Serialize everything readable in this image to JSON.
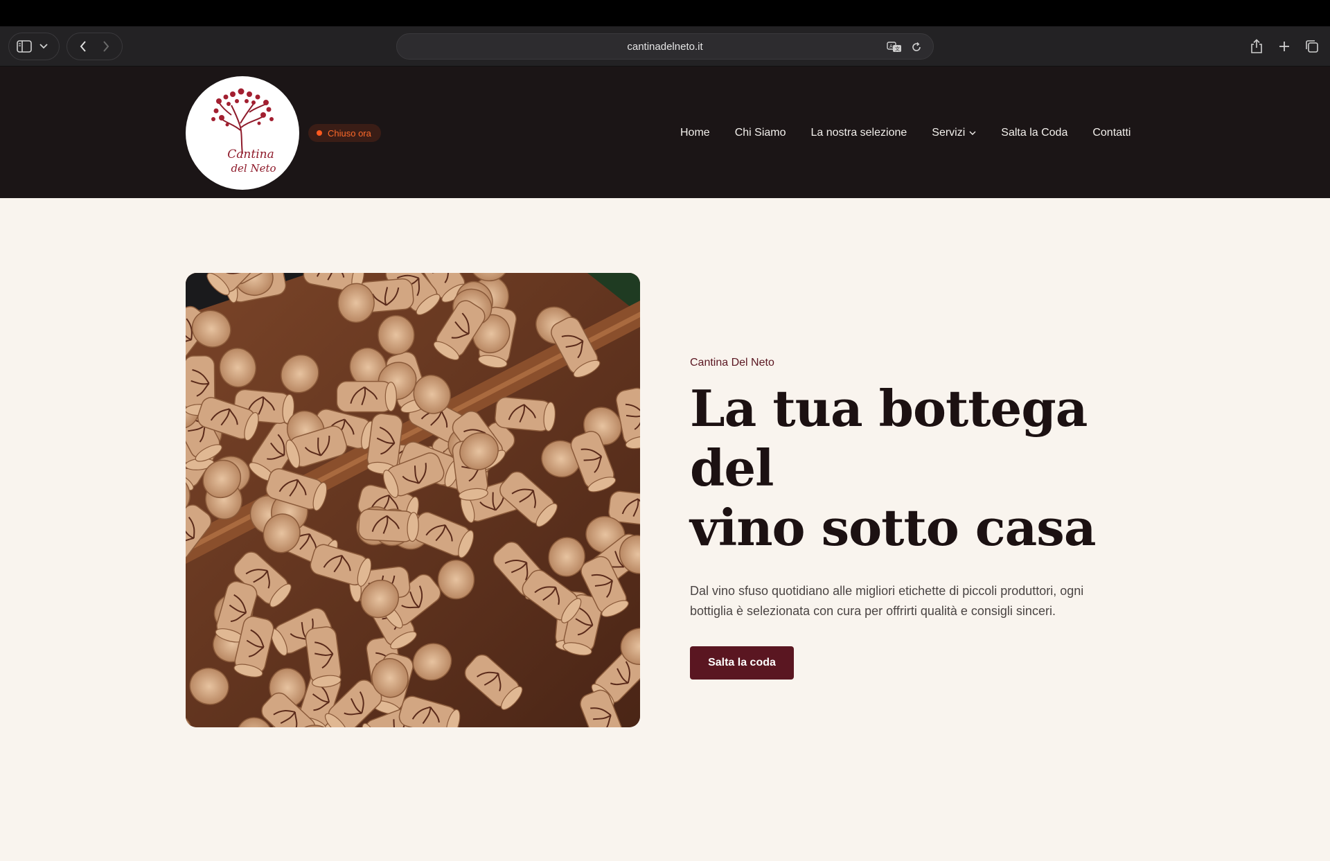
{
  "browser": {
    "url": "cantinadelneto.it",
    "icons": [
      "sidebar-icon",
      "chevron-down-icon",
      "back-icon",
      "forward-icon",
      "translate-icon",
      "reload-icon",
      "share-icon",
      "new-tab-icon",
      "tabs-overview-icon"
    ]
  },
  "header": {
    "logo": {
      "line1": "Cantina",
      "line2": "del Neto"
    },
    "status": {
      "text": "Chiuso ora",
      "color": "#ff5a1f"
    },
    "nav": [
      {
        "label": "Home"
      },
      {
        "label": "Chi Siamo"
      },
      {
        "label": "La nostra selezione"
      },
      {
        "label": "Servizi",
        "has_dropdown": true
      },
      {
        "label": "Salta la Coda"
      },
      {
        "label": "Contatti"
      }
    ]
  },
  "hero": {
    "eyebrow": "Cantina Del Neto",
    "title_line1": "La tua bottega del",
    "title_line2": "vino sotto casa",
    "description": "Dal vino sfuso quotidiano alle migliori etichette di piccoli produttori, ogni bottiglia è selezionata con cura per offrirti qualità e consigli sinceri.",
    "cta_label": "Salta la coda"
  },
  "colors": {
    "header_bg": "#1b1516",
    "page_bg": "#f9f4ee",
    "accent": "#5a1621",
    "status": "#ff5a1f"
  }
}
